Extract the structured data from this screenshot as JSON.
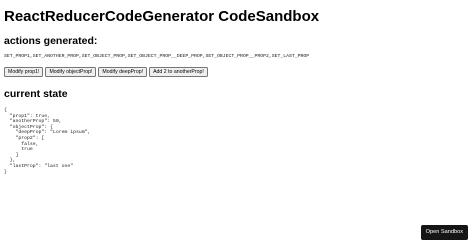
{
  "title": "ReactReducerCodeGenerator CodeSandbox",
  "actions": {
    "heading": "actions generated:",
    "list_text": "SET_PROP1,SET_ANOTHER_PROP,SET_OBJECT_PROP,SET_OBJECT_PROP__DEEP_PROP,SET_OBJECT_PROP__PROP2,SET_LAST_PROP"
  },
  "buttons": [
    {
      "label": "Modify prop1!"
    },
    {
      "label": "Modify objectProp!"
    },
    {
      "label": "Modify deepProp!"
    },
    {
      "label": "Add 2 to anotherProp!"
    }
  ],
  "state": {
    "heading": "current state",
    "json_text": "{\n  \"prop1\": true,\n  \"anotherProp\": 50,\n  \"objectProp\": {\n    \"deepProp\": \"Lorem ipsum\",\n    \"prop2\": [\n      false,\n      true\n    ]\n  },\n  \"lastProp\": \"last one\"\n}"
  },
  "sandbox_button": {
    "label": "Open Sandbox"
  },
  "colors": {
    "sandbox_button_bg": "#151515",
    "button_bg": "#efefef"
  }
}
